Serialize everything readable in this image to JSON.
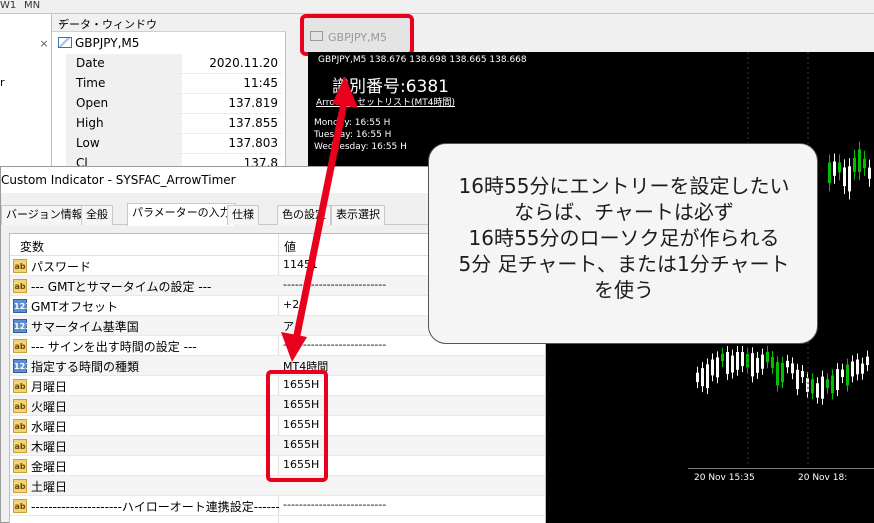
{
  "top_strip": {
    "items": [
      "W1",
      "MN"
    ]
  },
  "navigator": {
    "close_glyph": "×",
    "cut_text": "r"
  },
  "data_window": {
    "title": "データ・ウィンドウ",
    "close_glyph": "×",
    "symbol": "GBPJPY,M5",
    "rows": [
      {
        "label": "Date",
        "value": "2020.11.20"
      },
      {
        "label": "Time",
        "value": "11:45"
      },
      {
        "label": "Open",
        "value": "137.819"
      },
      {
        "label": "High",
        "value": "137.855"
      },
      {
        "label": "Low",
        "value": "137.803"
      },
      {
        "label": "Cl",
        "value": "137.8"
      }
    ]
  },
  "chart": {
    "tab_label": "GBPJPY,M5",
    "header": "GBPJPY,M5  138.676 138.698 138.665 138.668",
    "id_label": "識別番号:6381",
    "indicator_name": "Arrow    er セットリスト(MT4時間)",
    "day_lines": [
      "Monday: 16:55 H",
      "Tuesday: 16:55 H",
      "Wednesday: 16:55 H"
    ],
    "time_axis": [
      "20 Nov 15:35",
      "20 Nov 18:"
    ],
    "colors": {
      "background": "#000000",
      "bull": "#00c000",
      "bear": "#ffffff"
    }
  },
  "dialog": {
    "title": "Custom Indicator - SYSFAC_ArrowTimer",
    "tabs": [
      "バージョン情報",
      "全般",
      "パラメーターの入力",
      "仕様",
      "色の設定",
      "表示選択"
    ],
    "active_tab": "パラメーターの入力",
    "columns": {
      "variable": "変数",
      "value": "値"
    },
    "params": [
      {
        "icon": "ab",
        "name": "パスワード",
        "value": "11451"
      },
      {
        "icon": "ab",
        "name": "--- GMTとサマータイムの設定 ---",
        "value": "--------------------------"
      },
      {
        "icon": "123",
        "name": "GMTオフセット",
        "value": "+2"
      },
      {
        "icon": "123",
        "name": "サマータイム基準国",
        "value": "ア"
      },
      {
        "icon": "ab",
        "name": "--- サインを出す時間の設定 ---",
        "value": "--------------------------"
      },
      {
        "icon": "123",
        "name": "指定する時間の種類",
        "value": "MT4時間"
      },
      {
        "icon": "ab",
        "name": "月曜日",
        "value": "1655H"
      },
      {
        "icon": "ab",
        "name": "火曜日",
        "value": "1655H"
      },
      {
        "icon": "ab",
        "name": "水曜日",
        "value": "1655H"
      },
      {
        "icon": "ab",
        "name": "木曜日",
        "value": "1655H"
      },
      {
        "icon": "ab",
        "name": "金曜日",
        "value": "1655H"
      },
      {
        "icon": "ab",
        "name": "土曜日",
        "value": ""
      },
      {
        "icon": "ab",
        "name": "---------------------ハイローオート連携設定------",
        "value": "--------------------------"
      }
    ]
  },
  "callout": {
    "lines": [
      "16時55分にエントリーを設定したい",
      "ならば、チャートは必ず",
      "16時55分のローソク足が作られる",
      "5分 足チャート、または1分チャート",
      "を使う"
    ]
  },
  "annotation_color": "#e8001c"
}
